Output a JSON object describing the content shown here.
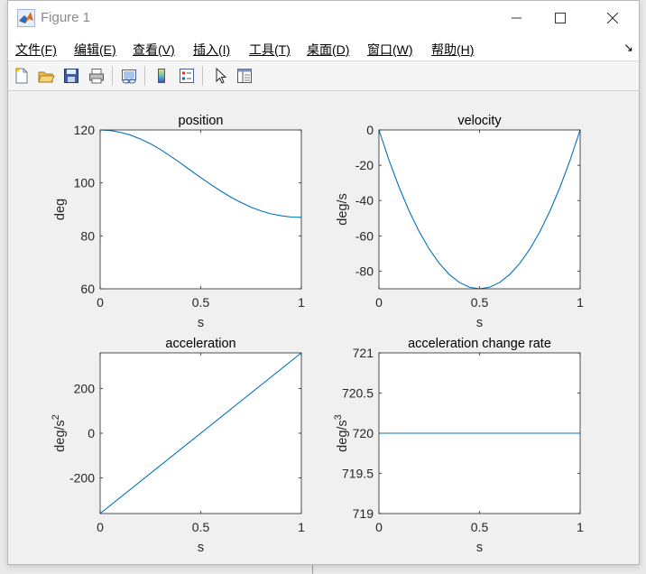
{
  "window": {
    "title": "Figure 1"
  },
  "menu": [
    {
      "label": "文件(F)"
    },
    {
      "label": "编辑(E)"
    },
    {
      "label": "查看(V)"
    },
    {
      "label": "插入(I)"
    },
    {
      "label": "工具(T)"
    },
    {
      "label": "桌面(D)"
    },
    {
      "label": "窗口(W)"
    },
    {
      "label": "帮助(H)"
    }
  ],
  "menu_overflow_glyph": "↘",
  "toolbar_icons": [
    "new-figure-icon",
    "open-file-icon",
    "save-icon",
    "print-icon",
    "link-plot-icon",
    "colorbar-icon",
    "legend-icon",
    "edit-plot-pointer-icon",
    "property-editor-icon"
  ],
  "colors": {
    "line": "#0072bd",
    "axes_bg": "#ffffff",
    "figure_bg": "#f0f0f0"
  },
  "chart_data": [
    {
      "type": "line",
      "title": "position",
      "xlabel": "s",
      "ylabel": "deg",
      "ylabel_sup": "",
      "xlim": [
        0,
        1
      ],
      "ylim": [
        60,
        120
      ],
      "xticks": [
        0,
        0.5,
        1
      ],
      "xtick_labels": [
        "0",
        "0.5",
        "1"
      ],
      "yticks": [
        60,
        80,
        100,
        120
      ],
      "ytick_labels": [
        "60",
        "80",
        "100",
        "120"
      ],
      "series": [
        {
          "x": [
            0,
            0.05,
            0.1,
            0.15,
            0.2,
            0.25,
            0.3,
            0.35,
            0.4,
            0.45,
            0.5,
            0.55,
            0.6,
            0.65,
            0.7,
            0.75,
            0.8,
            0.85,
            0.9,
            0.95,
            1
          ],
          "y": [
            120,
            119.8,
            119.1,
            118.1,
            116.6,
            114.8,
            112.6,
            110.1,
            107.5,
            104.7,
            102,
            99.4,
            96.9,
            94.6,
            92.6,
            90.8,
            89.4,
            88.3,
            87.6,
            87.1,
            87
          ]
        }
      ]
    },
    {
      "type": "line",
      "title": "velocity",
      "xlabel": "s",
      "ylabel": "deg/s",
      "ylabel_sup": "",
      "xlim": [
        0,
        1
      ],
      "ylim": [
        -90,
        0
      ],
      "xticks": [
        0,
        0.5,
        1
      ],
      "xtick_labels": [
        "0",
        "0.5",
        "1"
      ],
      "yticks": [
        -80,
        -60,
        -40,
        -20,
        0
      ],
      "ytick_labels": [
        "-80",
        "-60",
        "-40",
        "-20",
        "0"
      ],
      "series": [
        {
          "x": [
            0,
            0.05,
            0.1,
            0.15,
            0.2,
            0.25,
            0.3,
            0.35,
            0.4,
            0.45,
            0.5,
            0.55,
            0.6,
            0.65,
            0.7,
            0.75,
            0.8,
            0.85,
            0.9,
            0.95,
            1
          ],
          "y": [
            0,
            -17.1,
            -32.4,
            -45.9,
            -57.6,
            -67.5,
            -75.6,
            -81.9,
            -86.4,
            -89.1,
            -90,
            -89.1,
            -86.4,
            -81.9,
            -75.6,
            -67.5,
            -57.6,
            -45.9,
            -32.4,
            -17.1,
            0
          ]
        }
      ]
    },
    {
      "type": "line",
      "title": "acceleration",
      "xlabel": "s",
      "ylabel": "deg/s",
      "ylabel_sup": "2",
      "xlim": [
        0,
        1
      ],
      "ylim": [
        -360,
        360
      ],
      "xticks": [
        0,
        0.5,
        1
      ],
      "xtick_labels": [
        "0",
        "0.5",
        "1"
      ],
      "yticks": [
        -200,
        0,
        200
      ],
      "ytick_labels": [
        "-200",
        "0",
        "200"
      ],
      "series": [
        {
          "x": [
            0,
            1
          ],
          "y": [
            -360,
            360
          ]
        }
      ]
    },
    {
      "type": "line",
      "title": "acceleration change rate",
      "xlabel": "s",
      "ylabel": "deg/s",
      "ylabel_sup": "3",
      "xlim": [
        0,
        1
      ],
      "ylim": [
        719,
        721
      ],
      "xticks": [
        0,
        0.5,
        1
      ],
      "xtick_labels": [
        "0",
        "0.5",
        "1"
      ],
      "yticks": [
        719,
        719.5,
        720,
        720.5,
        721
      ],
      "ytick_labels": [
        "719",
        "719.5",
        "720",
        "720.5",
        "721"
      ],
      "series": [
        {
          "x": [
            0,
            1
          ],
          "y": [
            720,
            720
          ]
        }
      ]
    }
  ]
}
